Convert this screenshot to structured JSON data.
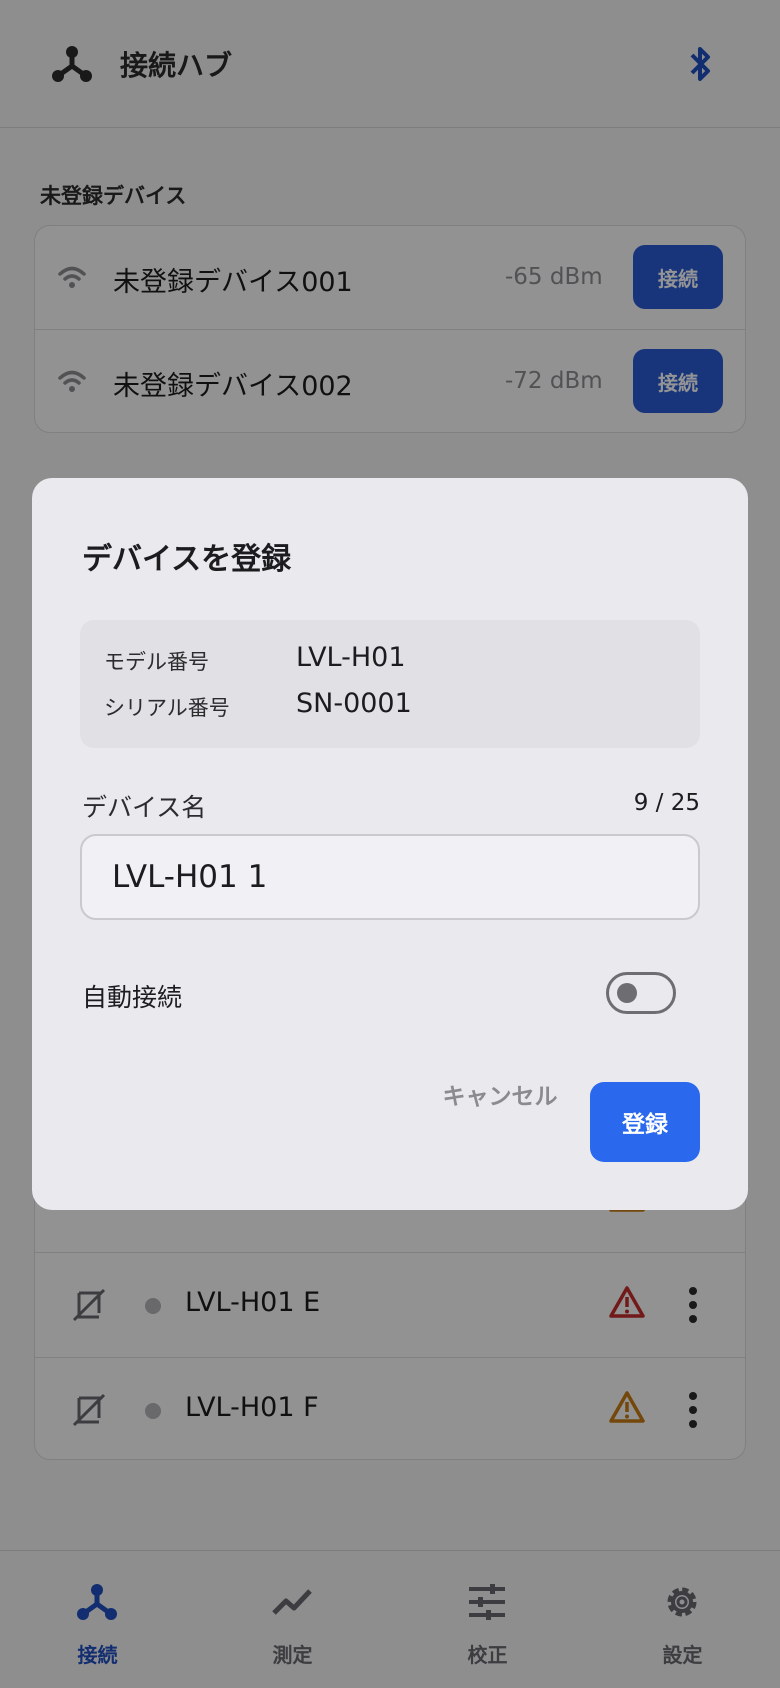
{
  "header": {
    "title": "接続ハブ",
    "icon": "hub-icon",
    "bluetooth_icon": "bluetooth-icon"
  },
  "unregistered": {
    "section_label": "未登録デバイス",
    "devices": [
      {
        "name": "未登録デバイス001",
        "signal": "-65 dBm",
        "button": "接続"
      },
      {
        "name": "未登録デバイス002",
        "signal": "-72 dBm",
        "button": "接続"
      }
    ]
  },
  "registered": {
    "devices": [
      {
        "name": "LVL-H01 E",
        "warning_color": "#c42b2b"
      },
      {
        "name": "LVL-H01 F",
        "warning_color": "#c87a12"
      }
    ]
  },
  "dialog": {
    "title": "デバイスを登録",
    "model_label": "モデル番号",
    "model_value": "LVL-H01",
    "serial_label": "シリアル番号",
    "serial_value": "SN-0001",
    "name_label": "デバイス名",
    "char_count": "9 / 25",
    "name_value": "LVL-H01 1",
    "auto_connect_label": "自動接続",
    "auto_connect_on": false,
    "cancel_label": "キャンセル",
    "register_label": "登録"
  },
  "bottom_nav": {
    "items": [
      {
        "label": "接続",
        "icon": "hub-icon",
        "active": true
      },
      {
        "label": "測定",
        "icon": "trend-icon",
        "active": false
      },
      {
        "label": "校正",
        "icon": "sliders-icon",
        "active": false
      },
      {
        "label": "設定",
        "icon": "gear-icon",
        "active": false
      }
    ]
  },
  "colors": {
    "accent": "#2a68ee",
    "nav_active": "#1f4fc2",
    "overlay": "rgba(0,0,0,0.42)"
  }
}
